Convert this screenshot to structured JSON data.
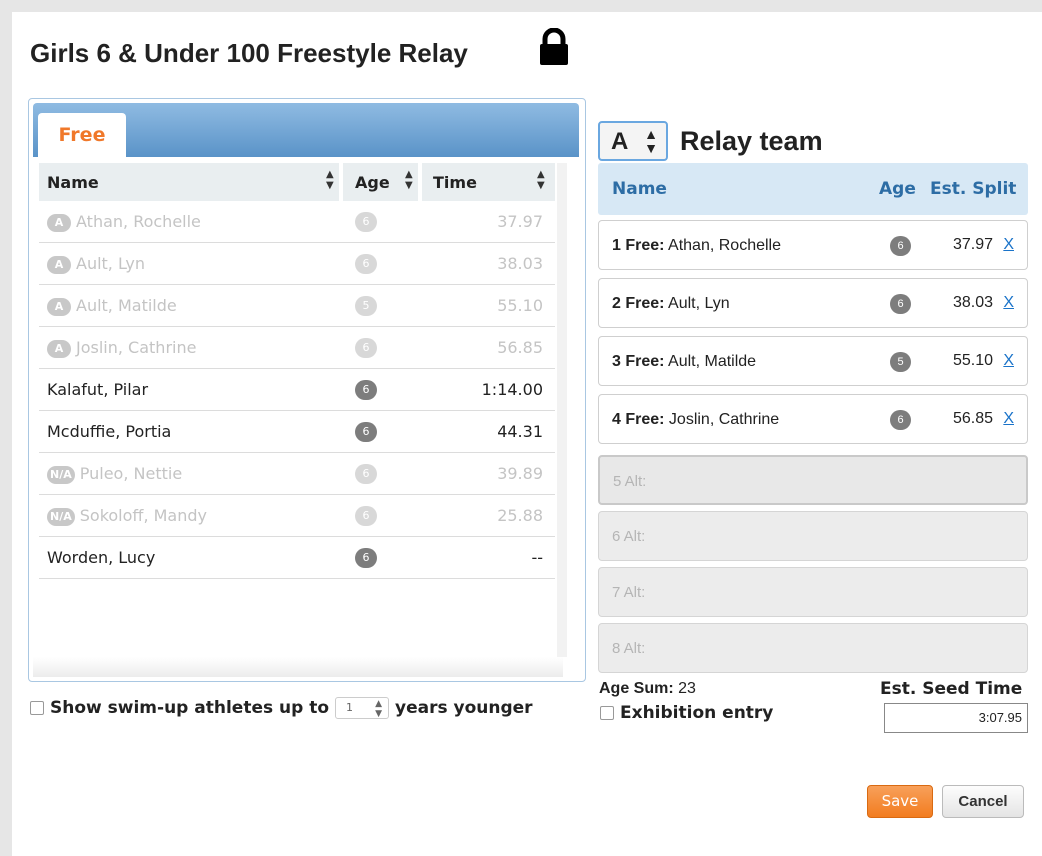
{
  "dialog": {
    "title": "Girls 6 & Under 100 Freestyle Relay",
    "lock_icon": "lock-icon"
  },
  "left_panel": {
    "tab_label": "Free",
    "columns": {
      "name": "Name",
      "age": "Age",
      "time": "Time"
    },
    "rows": [
      {
        "badge": "A",
        "name": "Athan, Rochelle",
        "age": "6",
        "time": "37.97",
        "dim": true
      },
      {
        "badge": "A",
        "name": "Ault, Lyn",
        "age": "6",
        "time": "38.03",
        "dim": true
      },
      {
        "badge": "A",
        "name": "Ault, Matilde",
        "age": "5",
        "time": "55.10",
        "dim": true
      },
      {
        "badge": "A",
        "name": "Joslin, Cathrine",
        "age": "6",
        "time": "56.85",
        "dim": true
      },
      {
        "badge": "",
        "name": "Kalafut, Pilar",
        "age": "6",
        "time": "1:14.00",
        "dim": false
      },
      {
        "badge": "",
        "name": "Mcduffie, Portia",
        "age": "6",
        "time": "44.31",
        "dim": false
      },
      {
        "badge": "N/A",
        "name": "Puleo, Nettie",
        "age": "6",
        "time": "39.89",
        "dim": true
      },
      {
        "badge": "N/A",
        "name": "Sokoloff, Mandy",
        "age": "6",
        "time": "25.88",
        "dim": true
      },
      {
        "badge": "",
        "name": "Worden, Lucy",
        "age": "6",
        "time": "--",
        "dim": false
      }
    ]
  },
  "swimup": {
    "label_before": "Show swim-up athletes up to",
    "years_value": "1",
    "label_after": "years younger"
  },
  "relay": {
    "team_value": "A",
    "title": "Relay team",
    "columns": {
      "name": "Name",
      "age": "Age",
      "split": "Est. Split"
    },
    "legs": [
      {
        "leg": "1 Free:",
        "name": "Athan, Rochelle",
        "age": "6",
        "split": "37.97",
        "remove": "X"
      },
      {
        "leg": "2 Free:",
        "name": "Ault, Lyn",
        "age": "6",
        "split": "38.03",
        "remove": "X"
      },
      {
        "leg": "3 Free:",
        "name": "Ault, Matilde",
        "age": "5",
        "split": "55.10",
        "remove": "X"
      },
      {
        "leg": "4 Free:",
        "name": "Joslin, Cathrine",
        "age": "6",
        "split": "56.85",
        "remove": "X"
      }
    ],
    "alternates": [
      "5 Alt:",
      "6 Alt:",
      "7 Alt:",
      "8 Alt:"
    ]
  },
  "summary": {
    "age_sum_label": "Age Sum:",
    "age_sum_value": "23",
    "exhibition_label": "Exhibition entry",
    "est_seed_label": "Est. Seed Time",
    "est_seed_value": "3:07.95"
  },
  "buttons": {
    "save": "Save",
    "cancel": "Cancel"
  },
  "colors": {
    "accent_orange": "#f27c1f",
    "header_blue": "#2d6da5",
    "link_blue": "#1a73c9"
  }
}
